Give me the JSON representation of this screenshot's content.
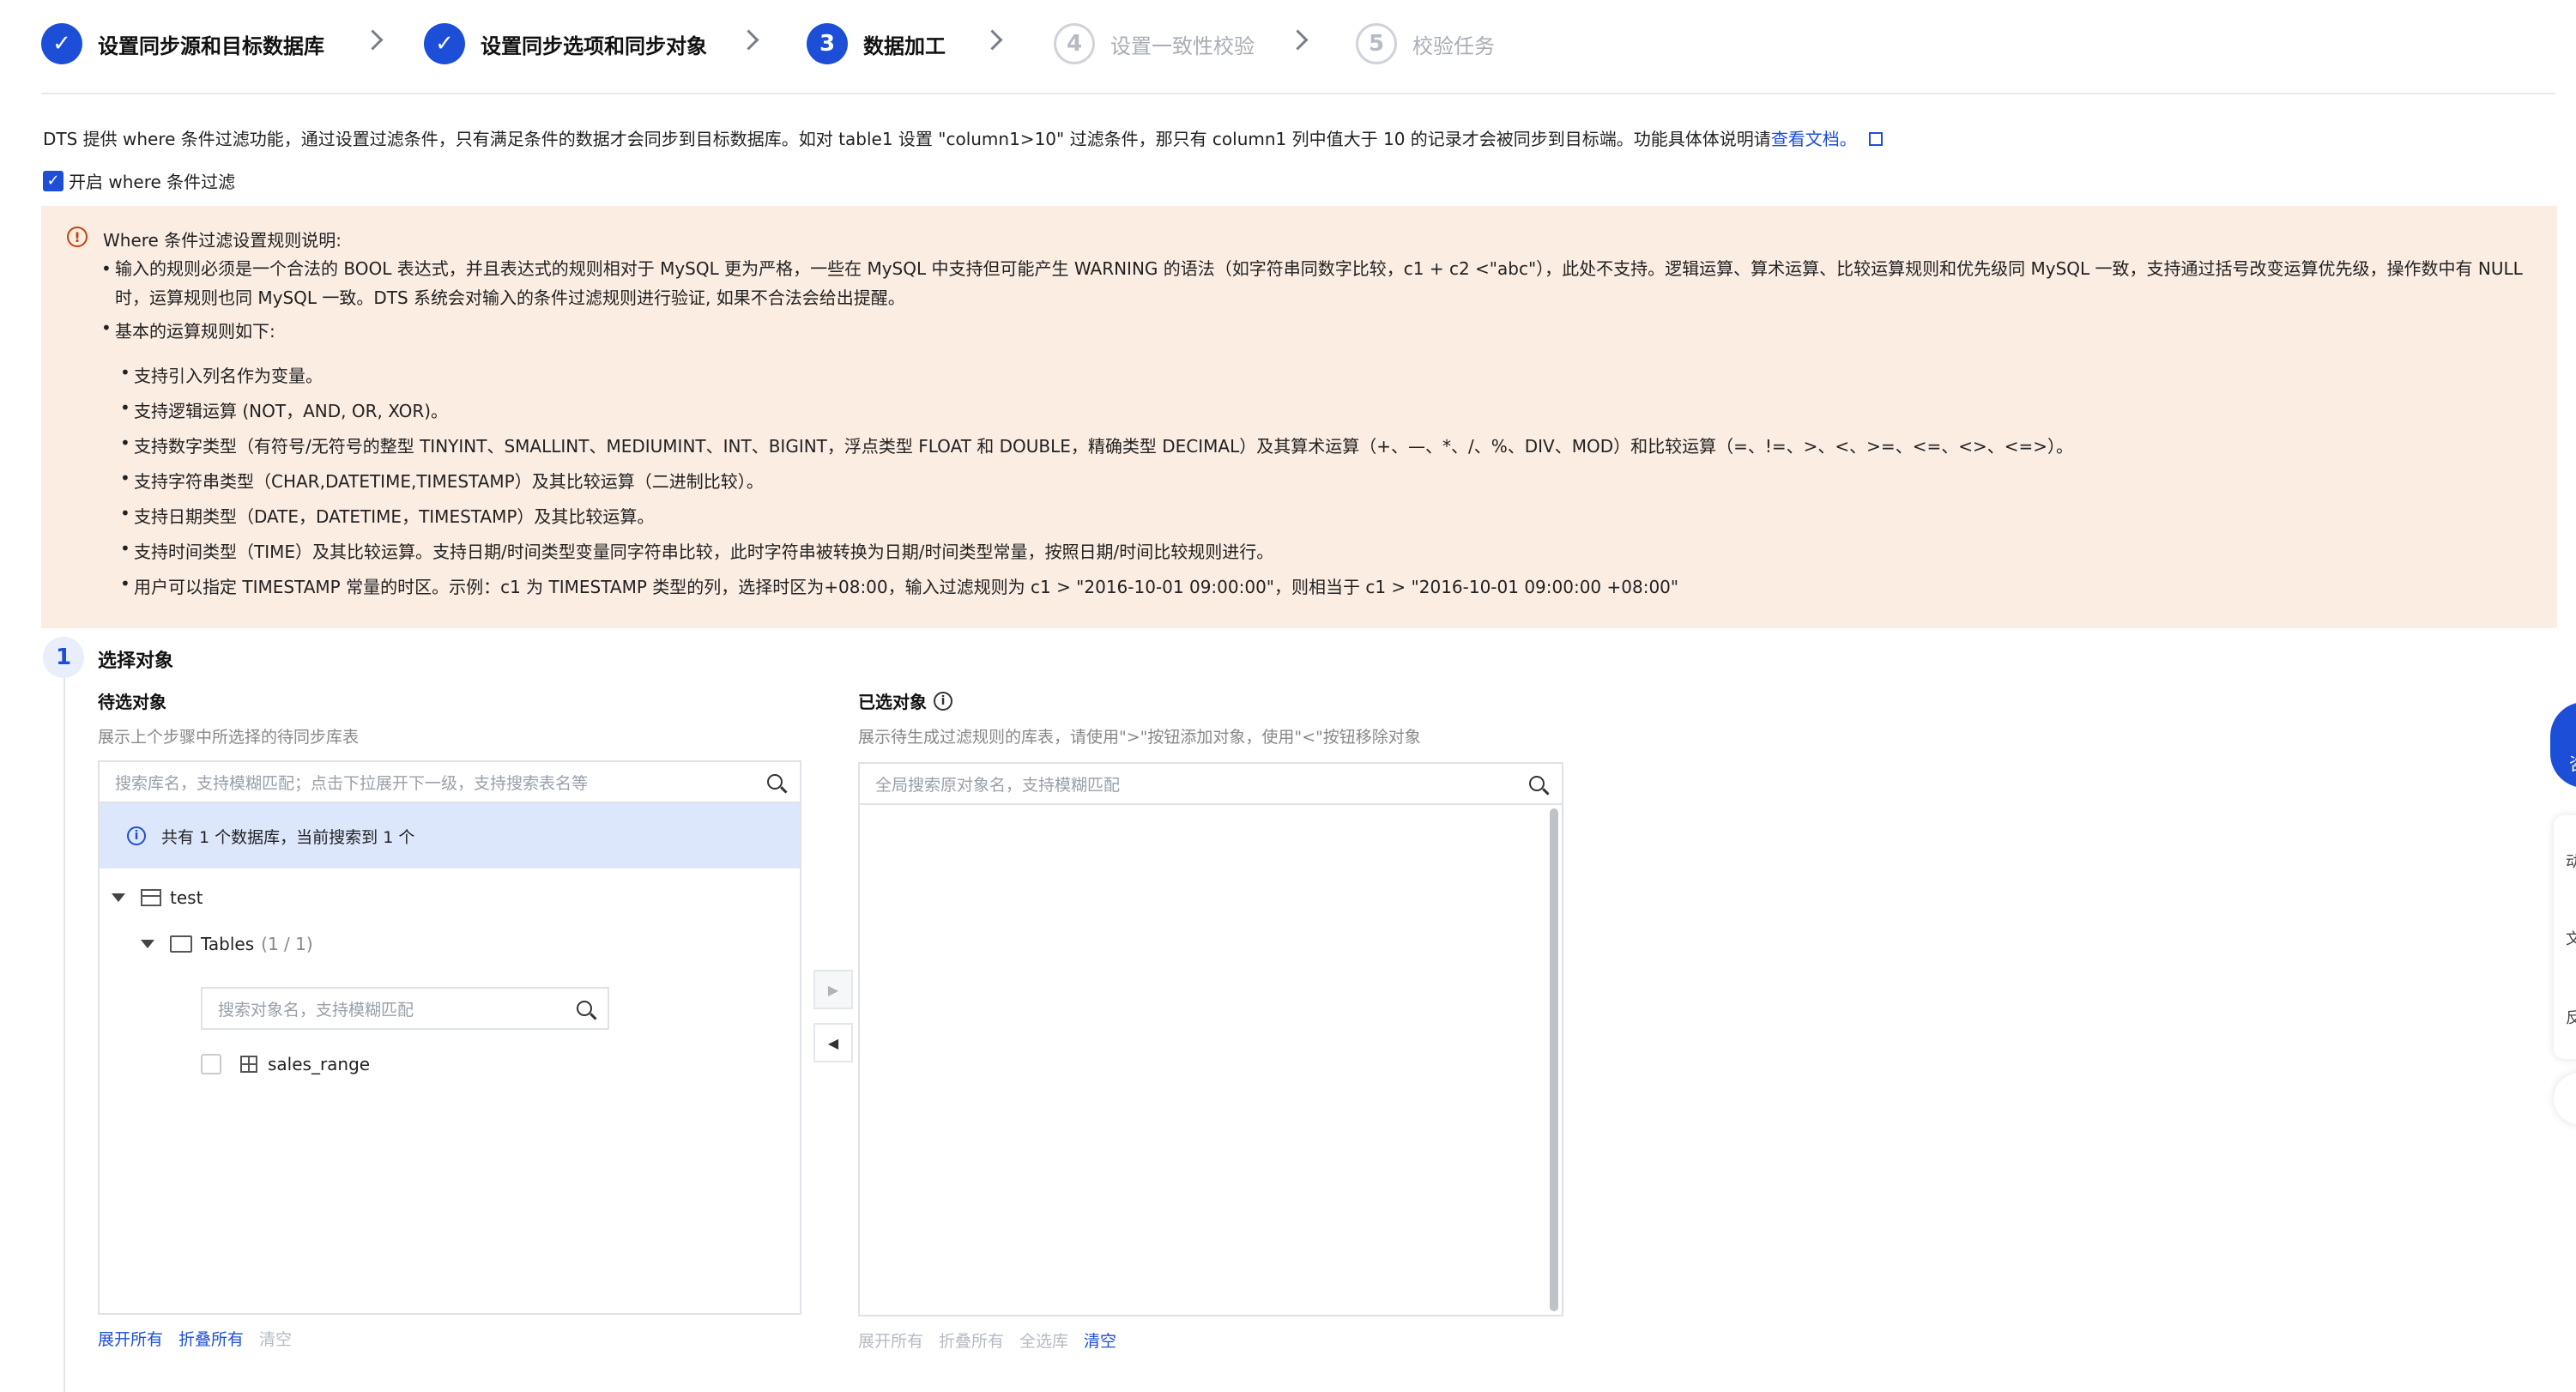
{
  "steps": [
    {
      "num": "1",
      "label": "设置同步源和目标数据库",
      "state": "done"
    },
    {
      "num": "2",
      "label": "设置同步选项和同步对象",
      "state": "done"
    },
    {
      "num": "3",
      "label": "数据加工",
      "state": "active"
    },
    {
      "num": "4",
      "label": "设置一致性校验",
      "state": "todo"
    },
    {
      "num": "5",
      "label": "校验任务",
      "state": "todo"
    }
  ],
  "intro": {
    "text": "DTS 提供 where 条件过滤功能，通过设置过滤条件，只有满足条件的数据才会同步到目标数据库。如对 table1 设置 \"column1>10\" 过滤条件，那只有 column1 列中值大于 10 的记录才会被同步到目标端。功能具体体说明请",
    "link": "查看文档。"
  },
  "where_filter": {
    "label": "开启 where 条件过滤",
    "checked": true
  },
  "notice": {
    "title": "Where 条件过滤设置规则说明:",
    "bullet1": "输入的规则必须是一个合法的 BOOL 表达式，并且表达式的规则相对于 MySQL 更为严格，一些在 MySQL 中支持但可能产生 WARNING 的语法（如字符串同数字比较，c1 + c2 <\"abc\"），此处不支持。逻辑运算、算术运算、比较运算规则和优先级同 MySQL 一致，支持通过括号改变运算优先级，操作数中有 NULL 时，运算规则也同 MySQL 一致。DTS 系统会对输入的条件过滤规则进行验证, 如果不合法会给出提醒。",
    "bullet2": "基本的运算规则如下:",
    "rules": [
      "支持引入列名作为变量。",
      "支持逻辑运算 (NOT，AND, OR, XOR)。",
      "支持数字类型（有符号/无符号的整型 TINYINT、SMALLINT、MEDIUMINT、INT、BIGINT，浮点类型 FLOAT 和 DOUBLE，精确类型 DECIMAL）及其算术运算（+、—、*、/、%、DIV、MOD）和比较运算（=、!=、>、<、>=、<=、<>、<=>）。",
      "支持字符串类型（CHAR,DATETIME,TIMESTAMP）及其比较运算（二进制比较）。",
      "支持日期类型（DATE，DATETIME，TIMESTAMP）及其比较运算。",
      "支持时间类型（TIME）及其比较运算。支持日期/时间类型变量同字符串比较，此时字符串被转换为日期/时间类型常量，按照日期/时间比较规则进行。",
      "用户可以指定 TIMESTAMP 常量的时区。示例：c1 为 TIMESTAMP 类型的列，选择时区为+08:00，输入过滤规则为 c1 > \"2016-10-01 09:00:00\"，则相当于 c1 > \"2016-10-01 09:00:00 +08:00\""
    ]
  },
  "section": {
    "num": "1",
    "title": "选择对象"
  },
  "left": {
    "title": "待选对象",
    "subtitle": "展示上个步骤中所选择的待同步库表",
    "search_placeholder": "搜索库名，支持模糊匹配；点击下拉展开下一级，支持搜索表名等",
    "info": "共有 1 个数据库，当前搜索到 1 个",
    "db_name": "test",
    "folder_name": "Tables",
    "folder_count": "(1 / 1)",
    "obj_search_placeholder": "搜索对象名，支持模糊匹配",
    "table_name": "sales_range",
    "links": {
      "expand": "展开所有",
      "collapse": "折叠所有",
      "clear": "清空"
    }
  },
  "transfer": {
    "add": "▶",
    "remove": "◀"
  },
  "right": {
    "title": "已选对象",
    "subtitle": "展示待生成过滤规则的库表，请使用\">\"按钮添加对象，使用\"<\"按钮移除对象",
    "search_placeholder": "全局搜索原对象名，支持模糊匹配",
    "links": {
      "expand": "展开所有",
      "collapse": "折叠所有",
      "select_all": "全选库",
      "clear": "清空"
    }
  },
  "float": {
    "chat": "咨",
    "item1": "动",
    "item2": "文",
    "item3": "反"
  }
}
